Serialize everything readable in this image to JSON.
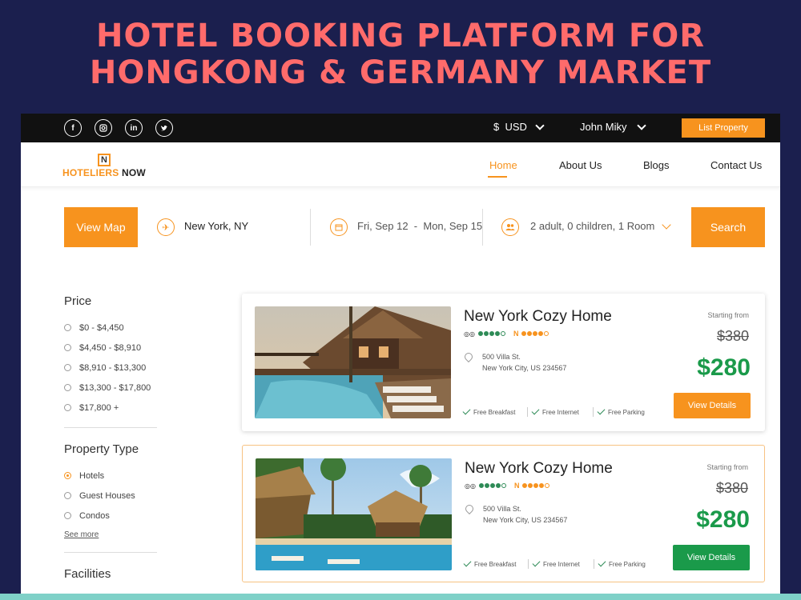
{
  "headline": {
    "line1": "HOTEL BOOKING PLATFORM FOR",
    "line2": "HONGKONG & GERMANY MARKET"
  },
  "topbar": {
    "socials": [
      "f",
      "ig",
      "in",
      "tw"
    ],
    "currency": "$  USD",
    "user": "John Miky",
    "list_property": "List Property"
  },
  "logo": {
    "mark": "N",
    "text_orange": "HOTELIERS",
    "text_dark": " NOW"
  },
  "nav": {
    "home": "Home",
    "about": "About Us",
    "blogs": "Blogs",
    "contact": "Contact Us"
  },
  "search": {
    "view_map": "View Map",
    "location": "New York, NY",
    "dates": "Fri, Sep 12  -  Mon, Sep 15",
    "guests": "2 adult, 0 children, 1 Room",
    "search_btn": "Search"
  },
  "filters": {
    "price_title": "Price",
    "prices": [
      "$0 - $4,450",
      "$4,450 - $8,910",
      "$8,910 - $13,300",
      "$13,300 - $17,800",
      "$17,800 +"
    ],
    "property_title": "Property Type",
    "properties": [
      "Hotels",
      "Guest Houses",
      "Condos"
    ],
    "see_more": "See more",
    "facilities_title": "Facilities"
  },
  "hotels": [
    {
      "name": "New York Cozy Home",
      "address1": "500 Villa St.",
      "address2": "New York City, US 234567",
      "amenities": [
        "Free Breakfast",
        "Free Internet",
        "Free Parking"
      ],
      "starting": "Starting from",
      "old_price": "$380",
      "price": "$280",
      "button": "View Details"
    },
    {
      "name": "New York Cozy Home",
      "address1": "500 Villa St.",
      "address2": "New York City, US 234567",
      "amenities": [
        "Free Breakfast",
        "Free Internet",
        "Free Parking"
      ],
      "starting": "Starting from",
      "old_price": "$380",
      "price": "$280",
      "button": "View Details"
    }
  ],
  "colors": {
    "accent": "#f7931e",
    "price_green": "#1a9a4a",
    "headline": "#ff6b6b",
    "background": "#1b1f4e"
  }
}
